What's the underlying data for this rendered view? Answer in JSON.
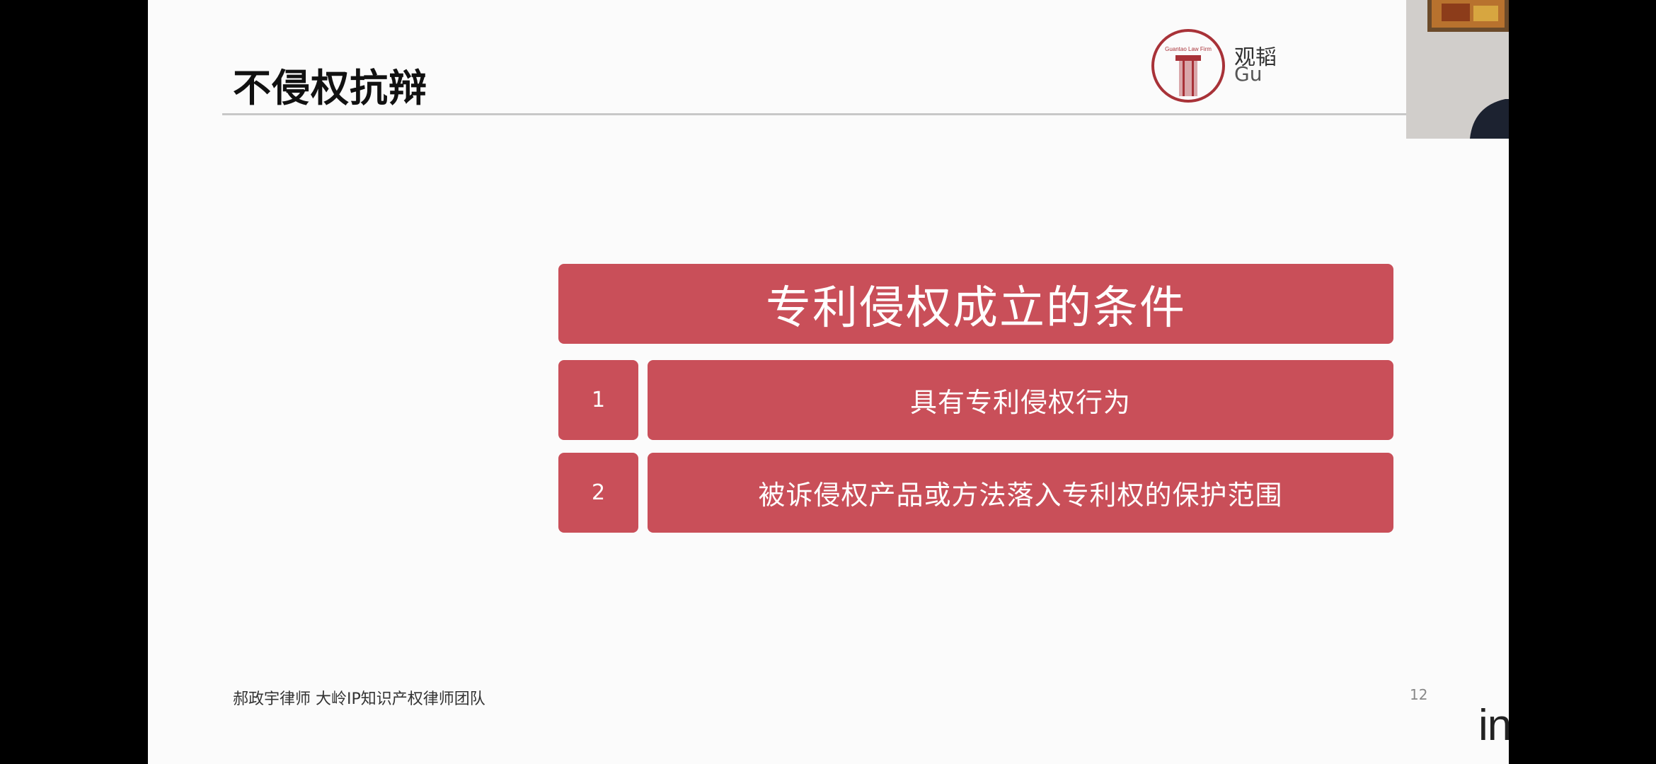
{
  "slide": {
    "title": "不侵权抗辩",
    "logo": {
      "ring_text": "Guantao Law Firm",
      "cn_partial": "观韬",
      "en_partial": "Gu"
    },
    "table": {
      "header": "专利侵权成立的条件",
      "rows": [
        {
          "number": "1",
          "text": "具有专利侵权行为"
        },
        {
          "number": "2",
          "text": "被诉侵权产品或方法落入专利权的保护范围"
        }
      ]
    },
    "footer": "郝政宇律师 大岭IP知识产权律师团队",
    "page_number": "12",
    "brand": "incoPat"
  },
  "colors": {
    "accent": "#c94f59",
    "logo_red": "#a83238",
    "background": "#fbfbfb"
  }
}
